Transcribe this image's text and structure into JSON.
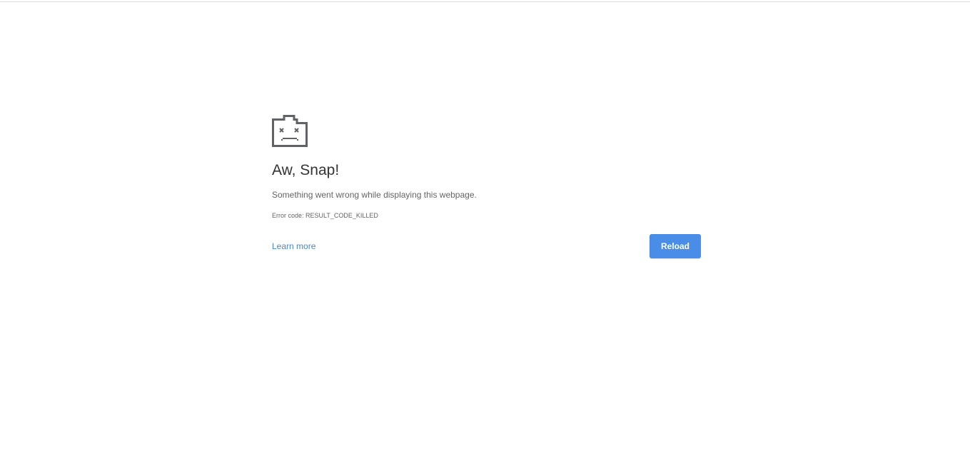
{
  "page": {
    "title": "Aw, Snap!",
    "message": "Something went wrong while displaying this webpage.",
    "error_code": "Error code: RESULT_CODE_KILLED",
    "learn_more_label": "Learn more",
    "reload_label": "Reload"
  },
  "icon": {
    "name": "sad-tab-icon",
    "color": "#5f6368"
  },
  "colors": {
    "link": "#4a86c7",
    "button": "#4a8de8",
    "title_text": "#333333",
    "body_text": "#646464"
  }
}
